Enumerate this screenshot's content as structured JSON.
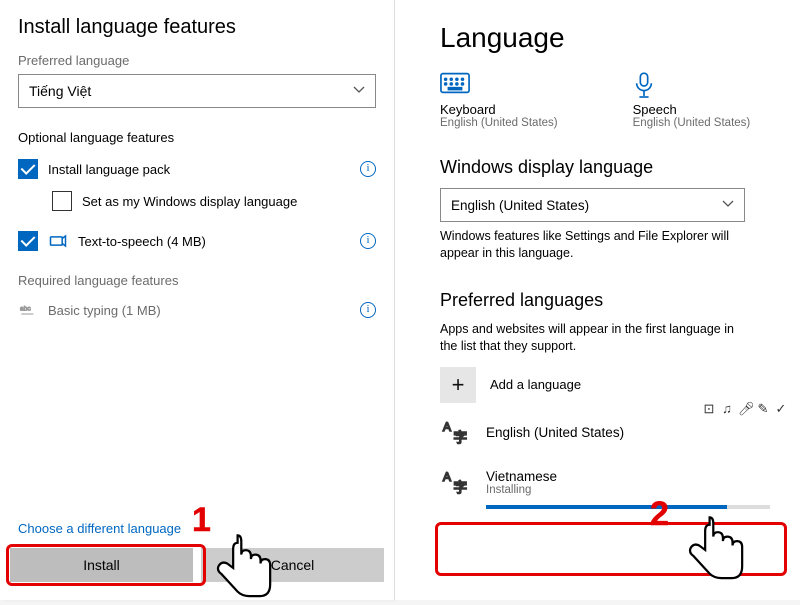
{
  "left": {
    "title": "Install language features",
    "preferred_label": "Preferred language",
    "preferred_value": "Tiếng Việt",
    "optional_header": "Optional language features",
    "features": {
      "lang_pack": "Install language pack",
      "set_display": "Set as my Windows display language",
      "tts": "Text-to-speech (4 MB)"
    },
    "required_header": "Required language features",
    "basic_typing": "Basic typing (1 MB)",
    "diff_lang_link": "Choose a different language",
    "install_btn": "Install",
    "cancel_btn": "Cancel"
  },
  "right": {
    "title": "Language",
    "keyboard_title": "Keyboard",
    "keyboard_sub": "English (United States)",
    "speech_title": "Speech",
    "speech_sub": "English (United States)",
    "wdl_header": "Windows display language",
    "wdl_value": "English (United States)",
    "wdl_desc": "Windows features like Settings and File Explorer will appear in this language.",
    "pref_header": "Preferred languages",
    "pref_desc": "Apps and websites will appear in the first language in the list that they support.",
    "add_lang": "Add a language",
    "lang1_name": "English (United States)",
    "lang2_name": "Vietnamese",
    "lang2_status": "Installing"
  },
  "callouts": {
    "one": "1",
    "two": "2"
  }
}
